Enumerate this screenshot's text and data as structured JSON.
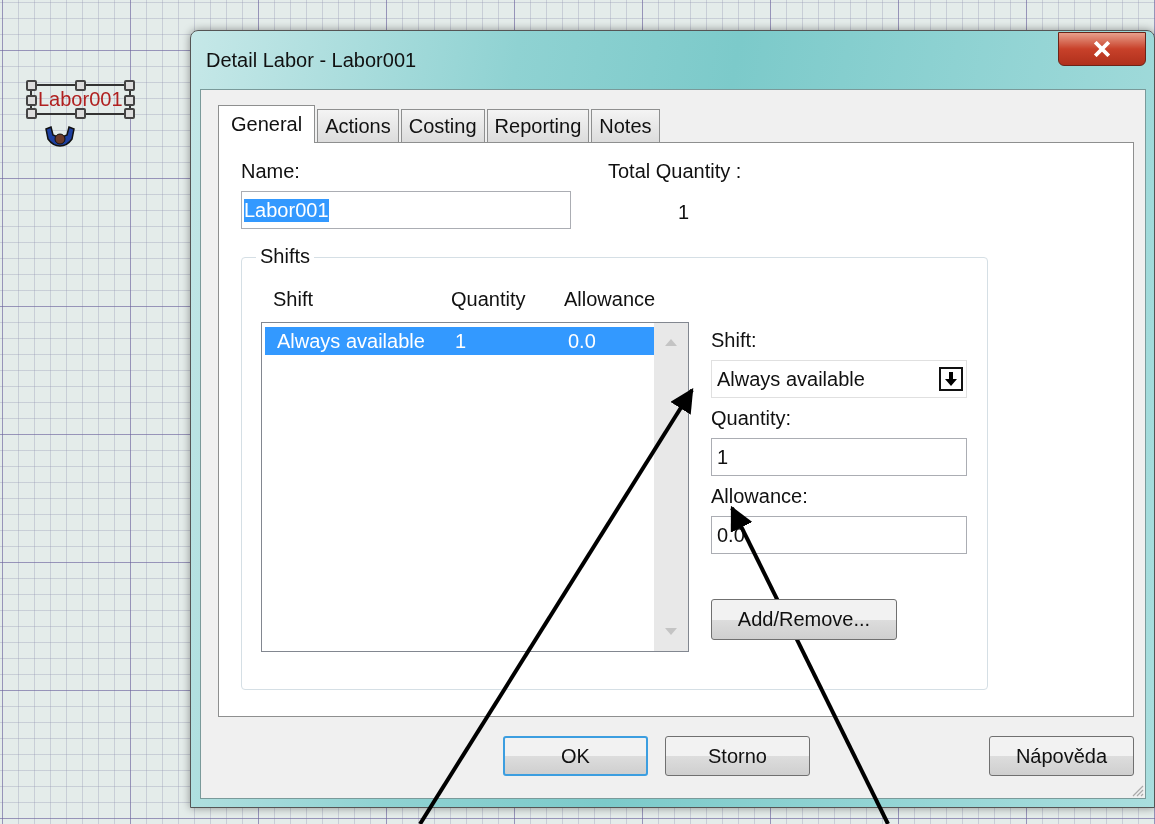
{
  "canvas": {
    "node": {
      "label": "Labor001",
      "selected": true
    }
  },
  "dialog": {
    "title": "Detail Labor - Labor001",
    "tabs": [
      {
        "label": "General",
        "selected": true
      },
      {
        "label": "Actions",
        "selected": false
      },
      {
        "label": "Costing",
        "selected": false
      },
      {
        "label": "Reporting",
        "selected": false
      },
      {
        "label": "Notes",
        "selected": false
      }
    ],
    "general": {
      "name_label": "Name:",
      "name_value": "Labor001",
      "name_text_selected": true,
      "total_quantity_label": "Total Quantity :",
      "total_quantity_value": "1",
      "shifts": {
        "title": "Shifts",
        "columns": [
          "Shift",
          "Quantity",
          "Allowance"
        ],
        "rows": [
          {
            "cells": [
              "Always available",
              "1",
              "0.0"
            ],
            "selected": true
          }
        ],
        "shift_label": "Shift:",
        "shift_value": "Always available",
        "quantity_label": "Quantity:",
        "quantity_value": "1",
        "allowance_label": "Allowance:",
        "allowance_value": "0.0",
        "add_remove": "Add/Remove..."
      }
    },
    "buttons": [
      {
        "label": "OK",
        "default": true
      },
      {
        "label": "Storno",
        "default": false
      },
      {
        "label": "Nápověda",
        "default": false
      }
    ]
  }
}
